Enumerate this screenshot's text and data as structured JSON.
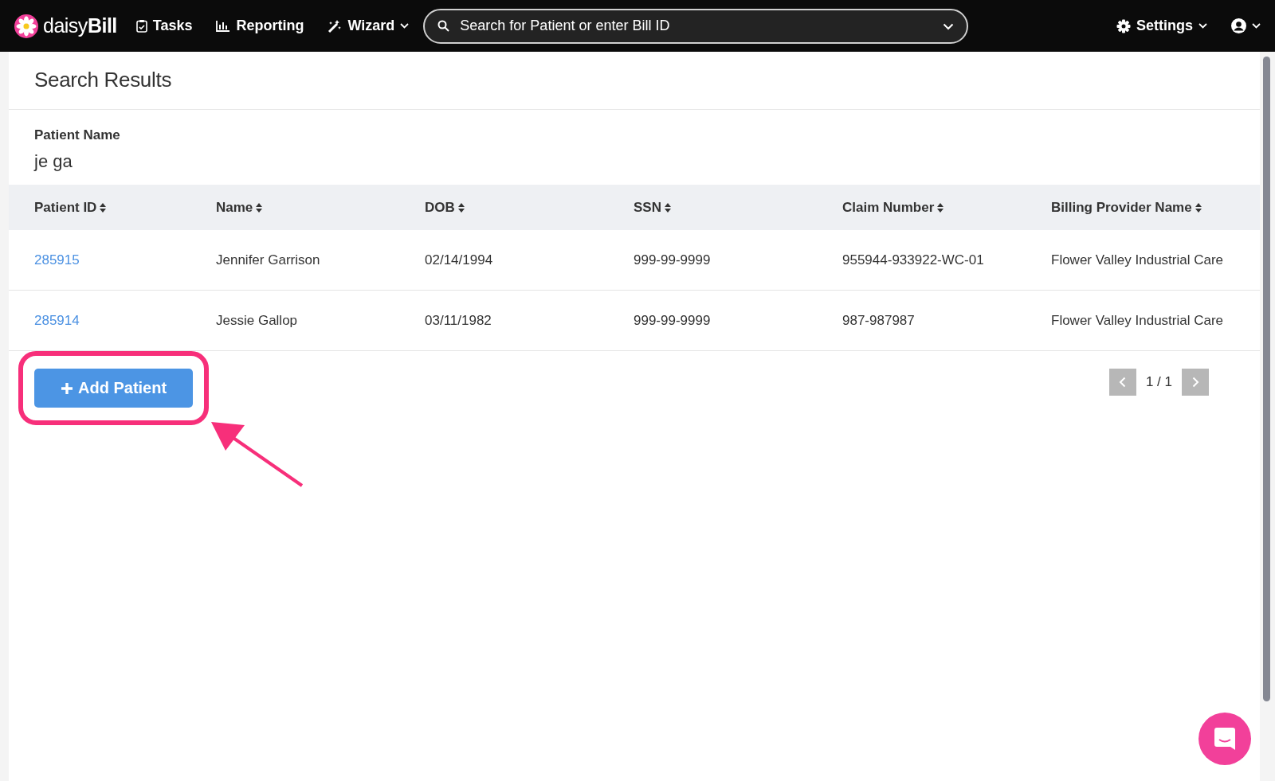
{
  "navbar": {
    "logo": {
      "light": "daisy",
      "bold": "Bill"
    },
    "items": [
      {
        "kind": "tasks",
        "label": "Tasks",
        "dropdown": false
      },
      {
        "kind": "reporting",
        "label": "Reporting",
        "dropdown": false
      },
      {
        "kind": "wizard",
        "label": "Wizard",
        "dropdown": true
      }
    ],
    "search": {
      "placeholder": "Search for Patient or enter Bill ID"
    },
    "settings": {
      "label": "Settings"
    }
  },
  "page": {
    "title": "Search Results",
    "filter": {
      "label": "Patient Name",
      "value": "je ga"
    }
  },
  "table": {
    "columns": [
      "Patient ID",
      "Name",
      "DOB",
      "SSN",
      "Claim Number",
      "Billing Provider Name"
    ],
    "rows": [
      [
        "285915",
        "Jennifer Garrison",
        "02/14/1994",
        "999-99-9999",
        "955944-933922-WC-01",
        "Flower Valley Industrial Care"
      ],
      [
        "285914",
        "Jessie Gallop",
        "03/11/1982",
        "999-99-9999",
        "987-987987",
        "Flower Valley Industrial Care"
      ]
    ]
  },
  "add_button": {
    "label": "Add Patient",
    "highlighted": true
  },
  "pagination": {
    "text": "1 / 1",
    "prev_disabled": true,
    "next_disabled": true
  }
}
